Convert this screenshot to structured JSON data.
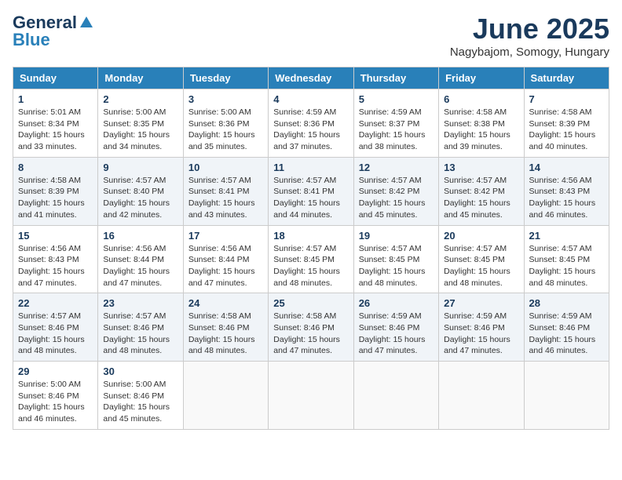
{
  "logo": {
    "general": "General",
    "blue": "Blue"
  },
  "title": "June 2025",
  "subtitle": "Nagybajom, Somogy, Hungary",
  "days_of_week": [
    "Sunday",
    "Monday",
    "Tuesday",
    "Wednesday",
    "Thursday",
    "Friday",
    "Saturday"
  ],
  "weeks": [
    [
      {
        "day": "1",
        "sunrise": "5:01 AM",
        "sunset": "8:34 PM",
        "daylight": "15 hours and 33 minutes."
      },
      {
        "day": "2",
        "sunrise": "5:00 AM",
        "sunset": "8:35 PM",
        "daylight": "15 hours and 34 minutes."
      },
      {
        "day": "3",
        "sunrise": "5:00 AM",
        "sunset": "8:36 PM",
        "daylight": "15 hours and 35 minutes."
      },
      {
        "day": "4",
        "sunrise": "4:59 AM",
        "sunset": "8:36 PM",
        "daylight": "15 hours and 37 minutes."
      },
      {
        "day": "5",
        "sunrise": "4:59 AM",
        "sunset": "8:37 PM",
        "daylight": "15 hours and 38 minutes."
      },
      {
        "day": "6",
        "sunrise": "4:58 AM",
        "sunset": "8:38 PM",
        "daylight": "15 hours and 39 minutes."
      },
      {
        "day": "7",
        "sunrise": "4:58 AM",
        "sunset": "8:39 PM",
        "daylight": "15 hours and 40 minutes."
      }
    ],
    [
      {
        "day": "8",
        "sunrise": "4:58 AM",
        "sunset": "8:39 PM",
        "daylight": "15 hours and 41 minutes."
      },
      {
        "day": "9",
        "sunrise": "4:57 AM",
        "sunset": "8:40 PM",
        "daylight": "15 hours and 42 minutes."
      },
      {
        "day": "10",
        "sunrise": "4:57 AM",
        "sunset": "8:41 PM",
        "daylight": "15 hours and 43 minutes."
      },
      {
        "day": "11",
        "sunrise": "4:57 AM",
        "sunset": "8:41 PM",
        "daylight": "15 hours and 44 minutes."
      },
      {
        "day": "12",
        "sunrise": "4:57 AM",
        "sunset": "8:42 PM",
        "daylight": "15 hours and 45 minutes."
      },
      {
        "day": "13",
        "sunrise": "4:57 AM",
        "sunset": "8:42 PM",
        "daylight": "15 hours and 45 minutes."
      },
      {
        "day": "14",
        "sunrise": "4:56 AM",
        "sunset": "8:43 PM",
        "daylight": "15 hours and 46 minutes."
      }
    ],
    [
      {
        "day": "15",
        "sunrise": "4:56 AM",
        "sunset": "8:43 PM",
        "daylight": "15 hours and 47 minutes."
      },
      {
        "day": "16",
        "sunrise": "4:56 AM",
        "sunset": "8:44 PM",
        "daylight": "15 hours and 47 minutes."
      },
      {
        "day": "17",
        "sunrise": "4:56 AM",
        "sunset": "8:44 PM",
        "daylight": "15 hours and 47 minutes."
      },
      {
        "day": "18",
        "sunrise": "4:57 AM",
        "sunset": "8:45 PM",
        "daylight": "15 hours and 48 minutes."
      },
      {
        "day": "19",
        "sunrise": "4:57 AM",
        "sunset": "8:45 PM",
        "daylight": "15 hours and 48 minutes."
      },
      {
        "day": "20",
        "sunrise": "4:57 AM",
        "sunset": "8:45 PM",
        "daylight": "15 hours and 48 minutes."
      },
      {
        "day": "21",
        "sunrise": "4:57 AM",
        "sunset": "8:45 PM",
        "daylight": "15 hours and 48 minutes."
      }
    ],
    [
      {
        "day": "22",
        "sunrise": "4:57 AM",
        "sunset": "8:46 PM",
        "daylight": "15 hours and 48 minutes."
      },
      {
        "day": "23",
        "sunrise": "4:57 AM",
        "sunset": "8:46 PM",
        "daylight": "15 hours and 48 minutes."
      },
      {
        "day": "24",
        "sunrise": "4:58 AM",
        "sunset": "8:46 PM",
        "daylight": "15 hours and 48 minutes."
      },
      {
        "day": "25",
        "sunrise": "4:58 AM",
        "sunset": "8:46 PM",
        "daylight": "15 hours and 47 minutes."
      },
      {
        "day": "26",
        "sunrise": "4:59 AM",
        "sunset": "8:46 PM",
        "daylight": "15 hours and 47 minutes."
      },
      {
        "day": "27",
        "sunrise": "4:59 AM",
        "sunset": "8:46 PM",
        "daylight": "15 hours and 47 minutes."
      },
      {
        "day": "28",
        "sunrise": "4:59 AM",
        "sunset": "8:46 PM",
        "daylight": "15 hours and 46 minutes."
      }
    ],
    [
      {
        "day": "29",
        "sunrise": "5:00 AM",
        "sunset": "8:46 PM",
        "daylight": "15 hours and 46 minutes."
      },
      {
        "day": "30",
        "sunrise": "5:00 AM",
        "sunset": "8:46 PM",
        "daylight": "15 hours and 45 minutes."
      },
      null,
      null,
      null,
      null,
      null
    ]
  ]
}
